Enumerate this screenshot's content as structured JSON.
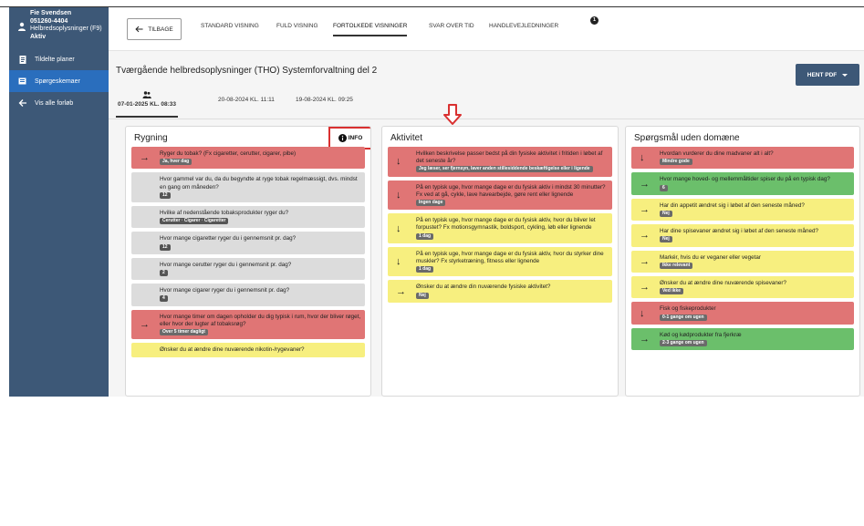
{
  "patient": {
    "name": "Fie Svendsen",
    "cpr": "051260-4404",
    "program": "Helbredsoplysninger (F9)",
    "status": "Aktiv"
  },
  "sidebar": {
    "items": [
      {
        "label": "Tildelte planer",
        "icon": "clipboard-icon"
      },
      {
        "label": "Spørgeskemaer",
        "icon": "questionnaire-icon"
      },
      {
        "label": "Vis alle forløb",
        "icon": "arrow-left-icon"
      }
    ]
  },
  "toolbar": {
    "back_label": "TILBAGE",
    "tabs": [
      "STANDARD VISNING",
      "FULD VISNING",
      "FORTOLKEDE VISNINGER",
      "SVAR OVER TID",
      "HANDLEVEJLEDNINGER"
    ],
    "active_tab": "FORTOLKEDE VISNINGER",
    "guidance_badge": "1"
  },
  "page": {
    "title": "Tværgående helbredsoplysninger (THO) Systemforvaltning del 2",
    "pdf_button": "HENT PDF"
  },
  "dates": [
    "07-01-2025 KL. 08:33",
    "20-08-2024 KL. 11:11",
    "19-08-2024 KL. 09:25"
  ],
  "columns": [
    {
      "title": "Rygning",
      "info_label": "INFO",
      "cards": [
        {
          "color": "red",
          "arrow": "→",
          "question": "Ryger du tobak? (Fx cigaretter, cerutter, cigarer, pibe)",
          "answer": "Ja, hver dag"
        },
        {
          "color": "gray",
          "arrow": "",
          "question": "Hvor gammel var du, da du begyndte at ryge tobak regelmæssigt, dvs. mindst en gang om måneden?",
          "answer": "12"
        },
        {
          "color": "gray",
          "arrow": "",
          "question": "Hvilke af nedenstående tobaksprodukter ryger du?",
          "answer": "Cerutter · Cigarer · Cigaretter"
        },
        {
          "color": "gray",
          "arrow": "",
          "question": "Hvor mange cigaretter ryger du i gennemsnit pr. dag?",
          "answer": "12"
        },
        {
          "color": "gray",
          "arrow": "",
          "question": "Hvor mange cerutter ryger du i gennemsnit pr. dag?",
          "answer": "2"
        },
        {
          "color": "gray",
          "arrow": "",
          "question": "Hvor mange cigarer ryger du i gennemsnit pr. dag?",
          "answer": "4"
        },
        {
          "color": "red",
          "arrow": "→",
          "question": "Hvor mange timer om dagen opholder du dig typisk i rum, hvor der bliver røget, eller hvor der lugter af tobaksrøg?",
          "answer": "Over 5 timer dagligt"
        },
        {
          "color": "yellow",
          "arrow": "",
          "question": "Ønsker du at ændre dine nuværende nikotin-/rygevaner?",
          "answer": ""
        }
      ]
    },
    {
      "title": "Aktivitet",
      "cards": [
        {
          "color": "red",
          "arrow": "↓",
          "question": "Hvilken beskrivelse passer bedst på din fysiske aktivitet i fritiden i løbet af det seneste år?",
          "answer": "Jeg læser, ser fjernsyn, laver anden stillesiddende beskæftigelse eller i ligende"
        },
        {
          "color": "red",
          "arrow": "↓",
          "question": "På en typisk uge, hvor mange dage er du fysisk aktiv i mindst 30 minutter? Fx ved at gå, cykle, lave havearbejde, gøre rent eller lignende",
          "answer": "Ingen dage"
        },
        {
          "color": "yellow",
          "arrow": "↓",
          "question": "På en typisk uge, hvor mange dage er du fysisk aktiv, hvor du bliver let forpustet? Fx motionsgymnastik, boldsport, cykling, løb eller lignende",
          "answer": "1 dag"
        },
        {
          "color": "yellow",
          "arrow": "↓",
          "question": "På en typisk uge, hvor mange dage er du fysisk aktiv, hvor du styrker dine muskler? Fx styrketræning, fitness eller lignende",
          "answer": "1 dag"
        },
        {
          "color": "yellow",
          "arrow": "→",
          "question": "Ønsker du at ændre din nuværende fysiske aktivitet?",
          "answer": "Nej"
        }
      ]
    },
    {
      "title": "Spørgsmål uden domæne",
      "cards": [
        {
          "color": "red",
          "arrow": "↓",
          "question": "Hvordan vurderer du dine madvaner alt i alt?",
          "answer": "Mindre gode"
        },
        {
          "color": "green",
          "arrow": "→",
          "question": "Hvor mange hoved- og mellemmåltider spiser du på en typisk dag?",
          "answer": "6"
        },
        {
          "color": "yellow",
          "arrow": "→",
          "question": "Har din appetit ændret sig i løbet af den seneste måned?",
          "answer": "Nej"
        },
        {
          "color": "yellow",
          "arrow": "→",
          "question": "Har dine spisevaner ændret sig i løbet af den seneste måned?",
          "answer": "Nej"
        },
        {
          "color": "yellow",
          "arrow": "→",
          "question": "Markér, hvis du er veganer eller vegetar",
          "answer": "Ikke relevant"
        },
        {
          "color": "yellow",
          "arrow": "→",
          "question": "Ønsker du at ændre dine nuværende spisevaner?",
          "answer": "Ved ikke"
        },
        {
          "color": "red",
          "arrow": "↓",
          "question": "Fisk og fiskeprodukter",
          "answer": "0-1 gange om ugen"
        },
        {
          "color": "green",
          "arrow": "→",
          "question": "Kød og kødprodukter fra fjerkræ",
          "answer": "2-3 gange om ugen"
        }
      ]
    }
  ],
  "colors": {
    "sidebar": "#3d5877",
    "sidebar_active": "#2a6ebd",
    "red": "#e07575",
    "gray": "#dcdcdc",
    "yellow": "#f7ef7f",
    "green": "#6bbf6b",
    "highlight": "#d93030"
  }
}
